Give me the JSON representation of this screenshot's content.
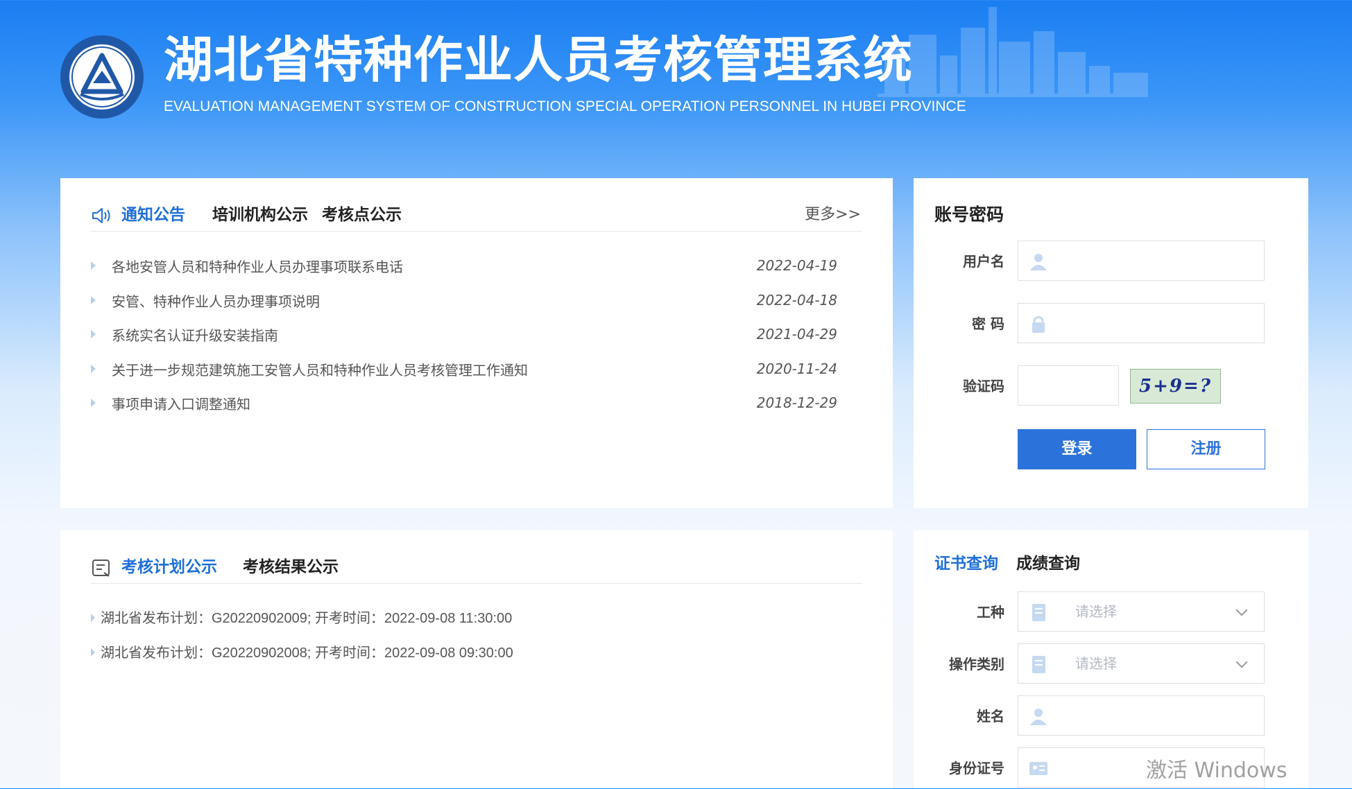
{
  "header": {
    "title": "湖北省特种作业人员考核管理系统",
    "subtitle": "EVALUATION MANAGEMENT SYSTEM OF CONSTRUCTION SPECIAL OPERATION PERSONNEL IN HUBEI PROVINCE"
  },
  "notice_panel": {
    "tabs": [
      {
        "label": "通知公告",
        "active": true
      },
      {
        "label": "培训机构公示",
        "active": false
      },
      {
        "label": "考核点公示",
        "active": false
      }
    ],
    "more": "更多>>",
    "items": [
      {
        "title": "各地安管人员和特种作业人员办理事项联系电话",
        "date": "2022-04-19"
      },
      {
        "title": "安管、特种作业人员办理事项说明",
        "date": "2022-04-18"
      },
      {
        "title": "系统实名认证升级安装指南",
        "date": "2021-04-29"
      },
      {
        "title": "关于进一步规范建筑施工安管人员和特种作业人员考核管理工作通知",
        "date": "2020-11-24"
      },
      {
        "title": "事项申请入口调整通知",
        "date": "2018-12-29"
      }
    ]
  },
  "plan_panel": {
    "tabs": [
      {
        "label": "考核计划公示",
        "active": true
      },
      {
        "label": "考核结果公示",
        "active": false
      }
    ],
    "items": [
      "湖北省发布计划：G20220902009; 开考时间：2022-09-08 11:30:00",
      "湖北省发布计划：G20220902008; 开考时间：2022-09-08 09:30:00"
    ]
  },
  "login_panel": {
    "title": "账号密码",
    "username_label": "用户名",
    "password_label": "密 码",
    "captcha_label": "验证码",
    "captcha_text": "5+9=?",
    "login_button": "登录",
    "register_button": "注册"
  },
  "query_panel": {
    "tabs": [
      {
        "label": "证书查询",
        "active": true
      },
      {
        "label": "成绩查询",
        "active": false
      }
    ],
    "work_type_label": "工种",
    "operation_label": "操作类别",
    "name_label": "姓名",
    "id_label": "身份证号",
    "select_placeholder": "请选择"
  },
  "watermark": "激活 Windows",
  "colors": {
    "accent": "#1e6fd9",
    "button": "#2b73da"
  }
}
